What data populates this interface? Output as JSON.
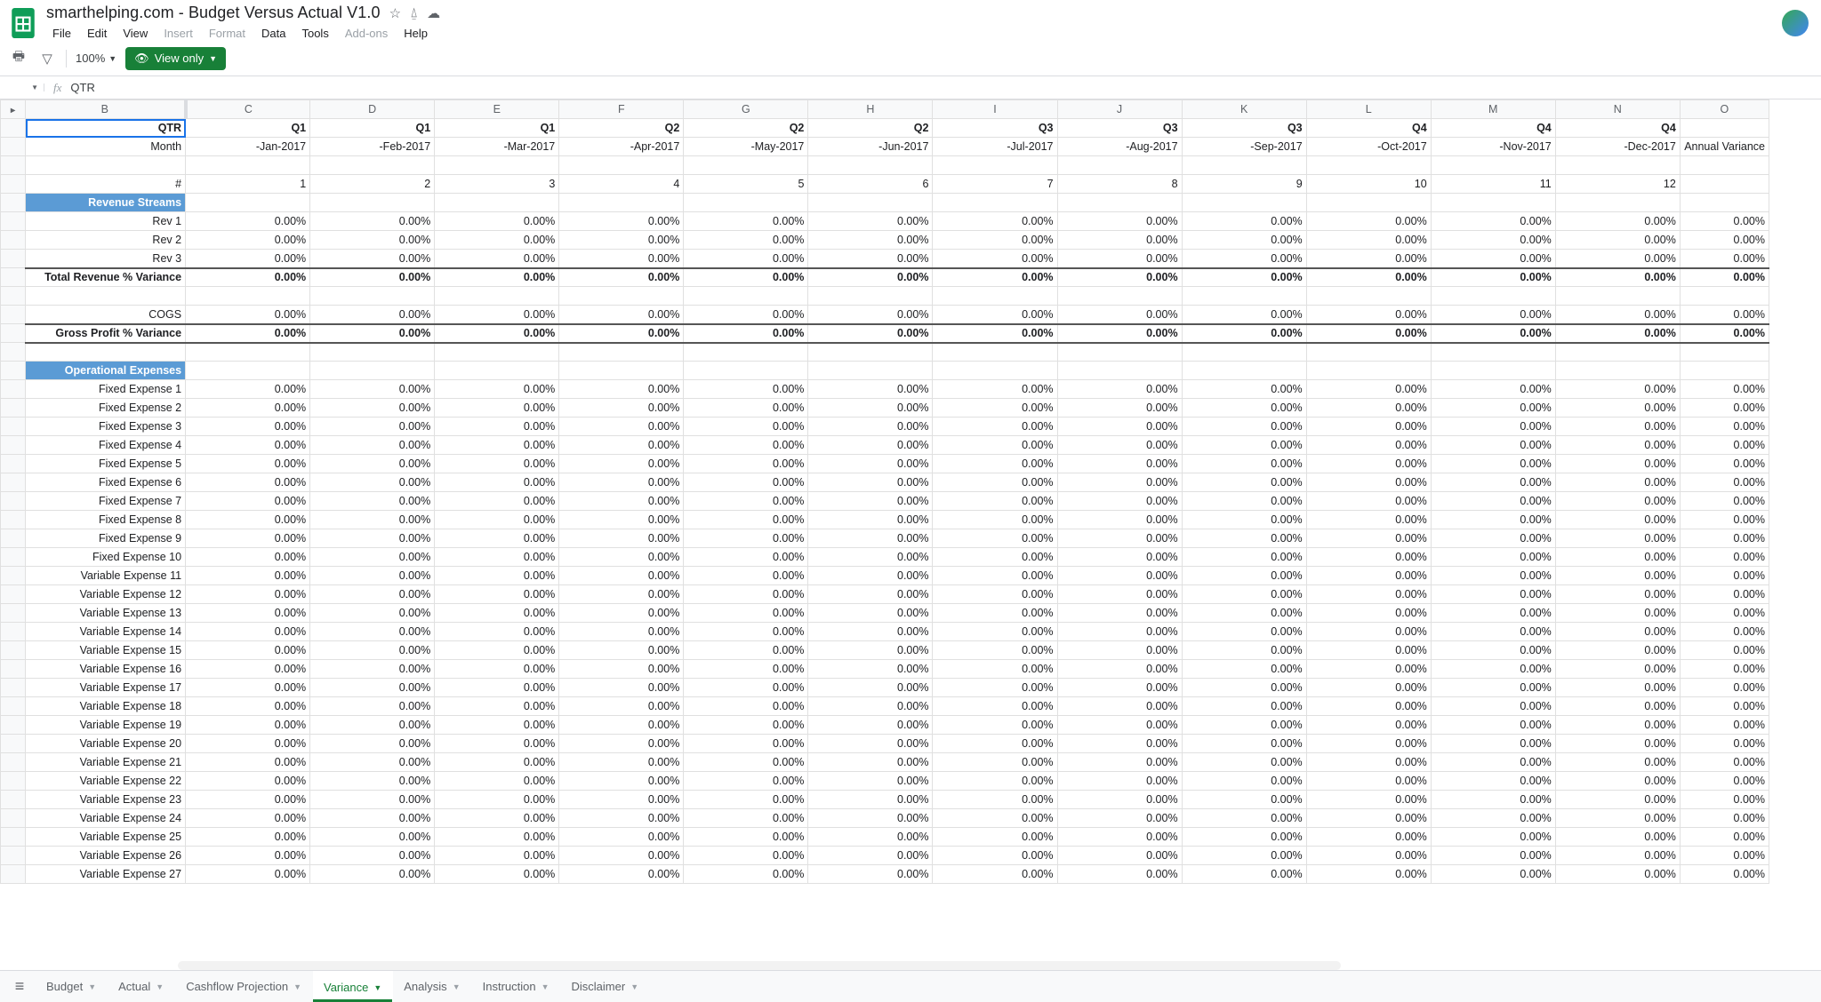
{
  "doc": {
    "title": "smarthelping.com - Budget Versus Actual V1.0"
  },
  "menus": [
    "File",
    "Edit",
    "View",
    "Insert",
    "Format",
    "Data",
    "Tools",
    "Add-ons",
    "Help"
  ],
  "menus_disabled": [
    "Insert",
    "Format",
    "Add-ons"
  ],
  "toolbar": {
    "zoom": "100%",
    "viewonly": "View only"
  },
  "fx": {
    "namebox": "",
    "value": "QTR"
  },
  "colHeaders": [
    "B",
    "C",
    "D",
    "E",
    "F",
    "G",
    "H",
    "I",
    "J",
    "K",
    "L",
    "M",
    "N",
    "O"
  ],
  "qtrRow": {
    "label": "QTR",
    "cells": [
      "Q1",
      "Q1",
      "Q1",
      "Q2",
      "Q2",
      "Q2",
      "Q3",
      "Q3",
      "Q3",
      "Q4",
      "Q4",
      "Q4",
      ""
    ]
  },
  "monthRow": {
    "label": "Month",
    "cells": [
      "-Jan-2017",
      "-Feb-2017",
      "-Mar-2017",
      "-Apr-2017",
      "-May-2017",
      "-Jun-2017",
      "-Jul-2017",
      "-Aug-2017",
      "-Sep-2017",
      "-Oct-2017",
      "-Nov-2017",
      "-Dec-2017",
      "Annual Variance"
    ]
  },
  "numRow": {
    "label": "#",
    "cells": [
      "1",
      "2",
      "3",
      "4",
      "5",
      "6",
      "7",
      "8",
      "9",
      "10",
      "11",
      "12",
      ""
    ]
  },
  "zeroCell": "0.00%",
  "rows": [
    {
      "type": "section",
      "label": "Revenue Streams"
    },
    {
      "type": "data",
      "label": "Rev 1"
    },
    {
      "type": "data",
      "label": "Rev 2"
    },
    {
      "type": "data",
      "label": "Rev 3"
    },
    {
      "type": "bold topline",
      "label": "Total Revenue % Variance"
    },
    {
      "type": "blank",
      "label": ""
    },
    {
      "type": "data",
      "label": "COGS"
    },
    {
      "type": "bold topline botline",
      "label": "Gross Profit % Variance"
    },
    {
      "type": "blank",
      "label": ""
    },
    {
      "type": "section",
      "label": "Operational Expenses"
    },
    {
      "type": "data",
      "label": "Fixed Expense 1"
    },
    {
      "type": "data",
      "label": "Fixed Expense 2"
    },
    {
      "type": "data",
      "label": "Fixed Expense 3"
    },
    {
      "type": "data",
      "label": "Fixed Expense 4"
    },
    {
      "type": "data",
      "label": "Fixed Expense 5"
    },
    {
      "type": "data",
      "label": "Fixed Expense 6"
    },
    {
      "type": "data",
      "label": "Fixed Expense 7"
    },
    {
      "type": "data",
      "label": "Fixed Expense 8"
    },
    {
      "type": "data",
      "label": "Fixed Expense 9"
    },
    {
      "type": "data",
      "label": "Fixed Expense 10"
    },
    {
      "type": "data",
      "label": "Variable Expense 11"
    },
    {
      "type": "data",
      "label": "Variable Expense 12"
    },
    {
      "type": "data",
      "label": "Variable Expense 13"
    },
    {
      "type": "data",
      "label": "Variable Expense 14"
    },
    {
      "type": "data",
      "label": "Variable Expense 15"
    },
    {
      "type": "data",
      "label": "Variable Expense 16"
    },
    {
      "type": "data",
      "label": "Variable Expense 17"
    },
    {
      "type": "data",
      "label": "Variable Expense 18"
    },
    {
      "type": "data",
      "label": "Variable Expense 19"
    },
    {
      "type": "data",
      "label": "Variable Expense 20"
    },
    {
      "type": "data",
      "label": "Variable Expense 21"
    },
    {
      "type": "data",
      "label": "Variable Expense 22"
    },
    {
      "type": "data",
      "label": "Variable Expense 23"
    },
    {
      "type": "data",
      "label": "Variable Expense 24"
    },
    {
      "type": "data",
      "label": "Variable Expense 25"
    },
    {
      "type": "data",
      "label": "Variable Expense 26"
    },
    {
      "type": "data",
      "label": "Variable Expense 27"
    }
  ],
  "tabs": [
    {
      "label": "Budget",
      "active": false
    },
    {
      "label": "Actual",
      "active": false
    },
    {
      "label": "Cashflow Projection",
      "active": false
    },
    {
      "label": "Variance",
      "active": true
    },
    {
      "label": "Analysis",
      "active": false
    },
    {
      "label": "Instruction",
      "active": false
    },
    {
      "label": "Disclaimer",
      "active": false
    }
  ],
  "colWidths": {
    "B": 180,
    "data": 140,
    "O": 100
  }
}
